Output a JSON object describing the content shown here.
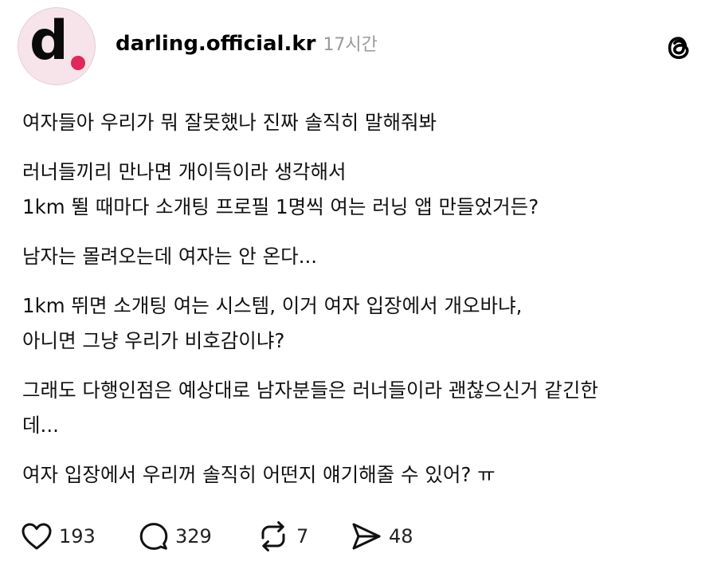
{
  "post": {
    "username": "darling.official.kr",
    "time": "17시간",
    "avatar_letter": "d",
    "lines": {
      "l1": "여자들아 우리가 뭐 잘못했나 진짜 솔직히 말해줘봐",
      "l2": " 러너들끼리 만나면 개이득이라 생각해서",
      "l3": "1km 뛸 때마다 소개팅 프로필 1명씩 여는 러닝 앱 만들었거든?",
      "l4": "남자는 몰려오는데 여자는 안 온다...",
      "l5": "1km 뛰면 소개팅 여는 시스템, 이거 여자 입장에서 개오바냐,",
      "l6": "아니면 그냥 우리가 비호감이냐?",
      "l7": "그래도 다행인점은 예상대로 남자분들은 러너들이라 괜찮으신거 같긴한",
      "l8": "데...",
      "l9": "여자 입장에서 우리꺼 솔직히 어떤지 얘기해줄 수 있어? ㅠ"
    }
  },
  "actions": {
    "likes": "193",
    "replies": "329",
    "reposts": "7",
    "shares": "48"
  },
  "icons": {
    "threads": "threads-logo-icon",
    "like": "heart-icon",
    "reply": "comment-bubble-icon",
    "repost": "repost-icon",
    "share": "send-icon"
  },
  "colors": {
    "avatar_bg": "#f7e3ea",
    "avatar_dot": "#e0285a",
    "time_text": "#9a9a9a"
  }
}
